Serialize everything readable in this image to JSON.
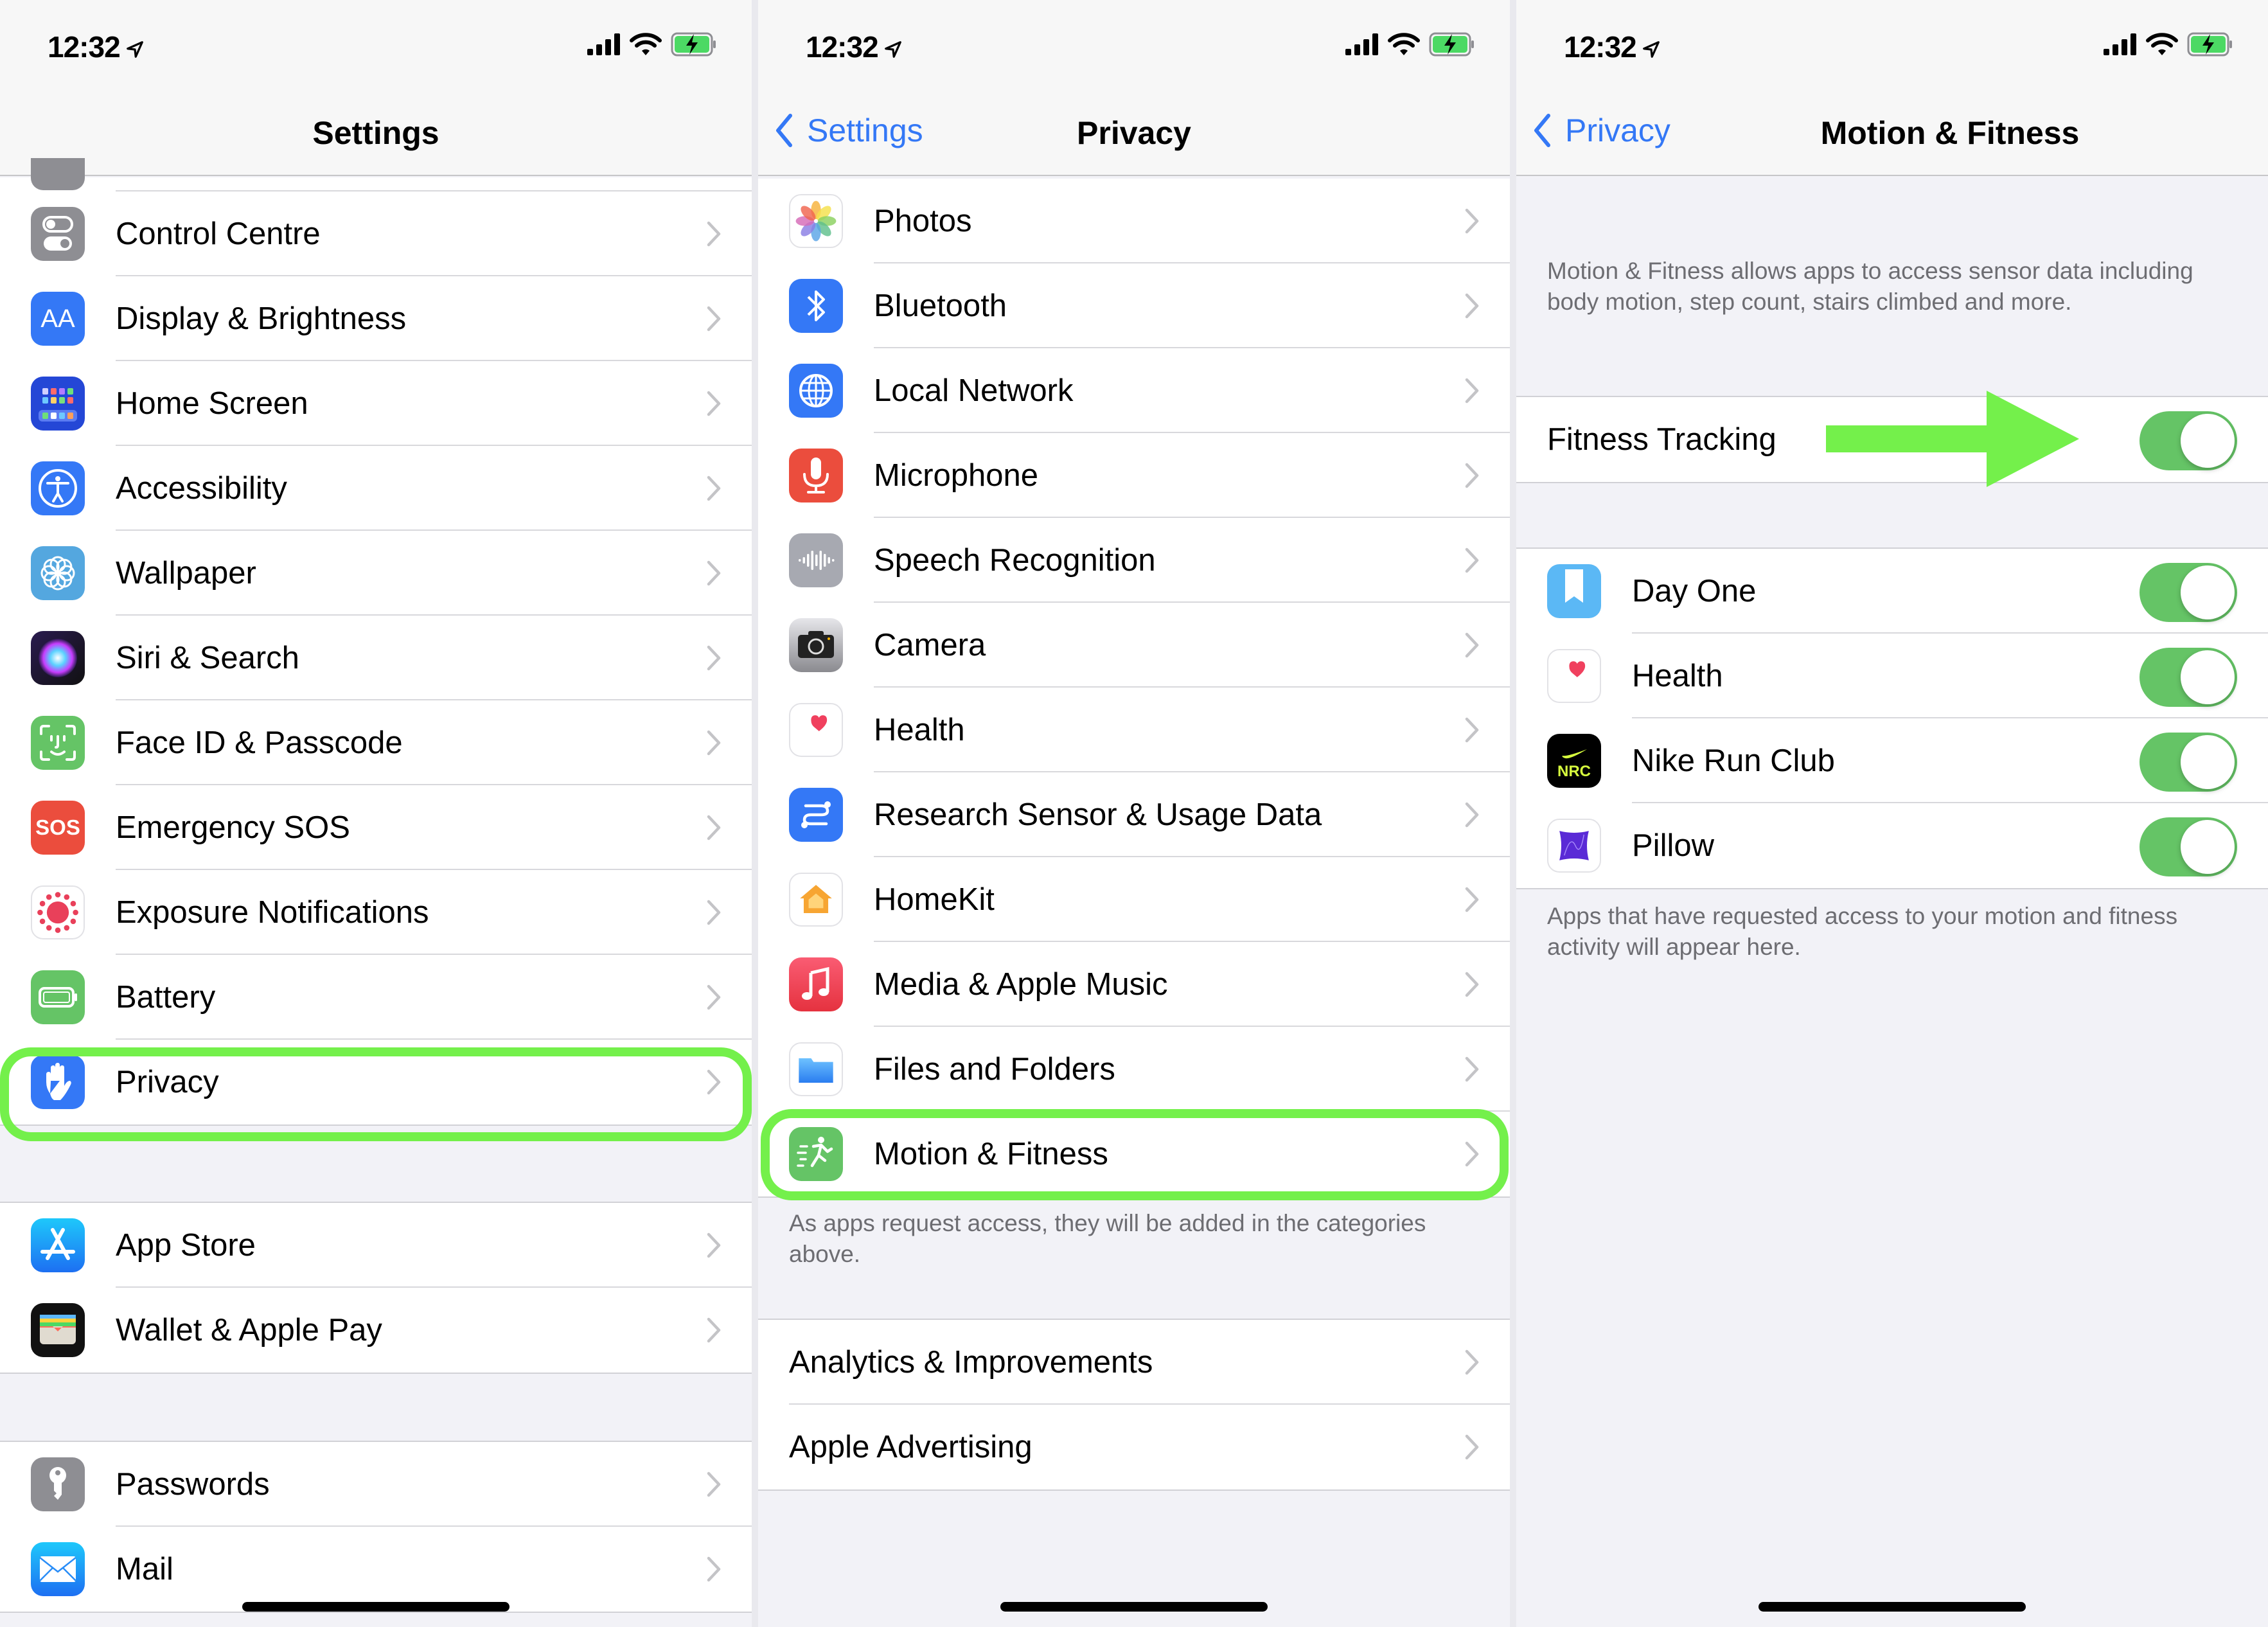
{
  "status_bar": {
    "time": "12:32"
  },
  "panels": {
    "settings": {
      "title": "Settings",
      "group1": [
        {
          "label": "Control Centre",
          "icon": "control-centre-icon"
        },
        {
          "label": "Display & Brightness",
          "icon": "display-brightness-icon"
        },
        {
          "label": "Home Screen",
          "icon": "home-screen-icon"
        },
        {
          "label": "Accessibility",
          "icon": "accessibility-icon"
        },
        {
          "label": "Wallpaper",
          "icon": "wallpaper-icon"
        },
        {
          "label": "Siri & Search",
          "icon": "siri-icon"
        },
        {
          "label": "Face ID & Passcode",
          "icon": "face-id-icon"
        },
        {
          "label": "Emergency SOS",
          "icon": "sos-icon",
          "icon_text": "SOS"
        },
        {
          "label": "Exposure Notifications",
          "icon": "exposure-notifications-icon"
        },
        {
          "label": "Battery",
          "icon": "battery-icon"
        },
        {
          "label": "Privacy",
          "icon": "privacy-hand-icon",
          "highlighted": true
        }
      ],
      "group2": [
        {
          "label": "App Store",
          "icon": "app-store-icon"
        },
        {
          "label": "Wallet & Apple Pay",
          "icon": "wallet-icon"
        }
      ],
      "group3": [
        {
          "label": "Passwords",
          "icon": "passwords-key-icon"
        },
        {
          "label": "Mail",
          "icon": "mail-icon"
        }
      ]
    },
    "privacy": {
      "back_label": "Settings",
      "title": "Privacy",
      "group1": [
        {
          "label": "Photos",
          "icon": "photos-icon"
        },
        {
          "label": "Bluetooth",
          "icon": "bluetooth-icon"
        },
        {
          "label": "Local Network",
          "icon": "local-network-globe-icon"
        },
        {
          "label": "Microphone",
          "icon": "microphone-icon"
        },
        {
          "label": "Speech Recognition",
          "icon": "speech-recognition-icon"
        },
        {
          "label": "Camera",
          "icon": "camera-icon"
        },
        {
          "label": "Health",
          "icon": "health-heart-icon"
        },
        {
          "label": "Research Sensor & Usage Data",
          "icon": "research-icon"
        },
        {
          "label": "HomeKit",
          "icon": "homekit-icon"
        },
        {
          "label": "Media & Apple Music",
          "icon": "music-icon"
        },
        {
          "label": "Files and Folders",
          "icon": "folder-icon"
        },
        {
          "label": "Motion & Fitness",
          "icon": "motion-fitness-icon",
          "highlighted": true
        }
      ],
      "footer": "As apps request access, they will be added in the categories above.",
      "group2": [
        {
          "label": "Analytics & Improvements"
        },
        {
          "label": "Apple Advertising"
        }
      ]
    },
    "motion_fitness": {
      "back_label": "Privacy",
      "title": "Motion & Fitness",
      "description": "Motion & Fitness allows apps to access sensor data including body motion, step count, stairs climbed and more.",
      "fitness_tracking": {
        "label": "Fitness Tracking",
        "on": true
      },
      "apps": [
        {
          "label": "Day One",
          "icon": "day-one-icon",
          "on": true
        },
        {
          "label": "Health",
          "icon": "health-heart-icon",
          "on": true
        },
        {
          "label": "Nike Run Club",
          "icon": "nike-run-club-icon",
          "icon_text": "NRC",
          "on": true
        },
        {
          "label": "Pillow",
          "icon": "pillow-icon",
          "on": true
        }
      ],
      "footer": "Apps that have requested access to your motion and fitness activity will appear here."
    }
  },
  "colors": {
    "accent_blue": "#3478f6",
    "toggle_on": "#65c466",
    "highlight_green": "#74f04b"
  }
}
